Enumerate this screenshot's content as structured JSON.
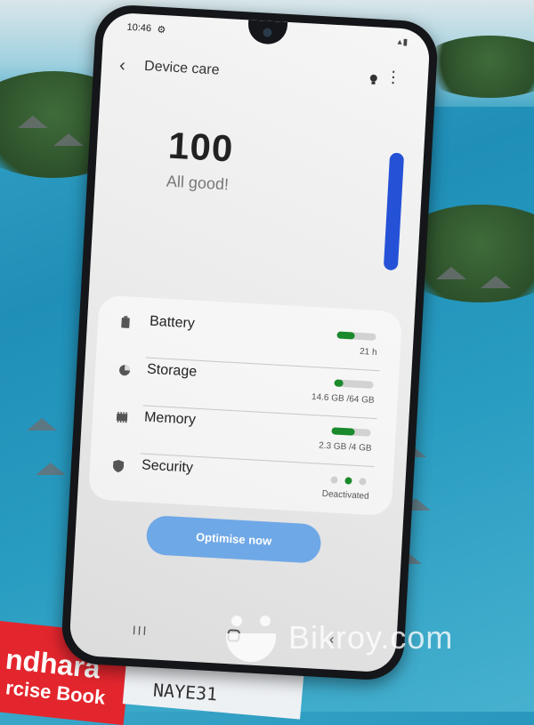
{
  "statusbar": {
    "time": "10:46",
    "gear_glyph": "⚙",
    "signal_glyph": "▴▮"
  },
  "appbar": {
    "back_glyph": "‹",
    "title": "Device care",
    "more_glyph": "⋮"
  },
  "summary": {
    "score": "100",
    "status": "All good!"
  },
  "items": [
    {
      "label": "Battery",
      "value": "21 h",
      "icon": "battery-icon",
      "fill": 0.45
    },
    {
      "label": "Storage",
      "value": "14.6 GB /64 GB",
      "icon": "storage-pie-icon",
      "fill": 0.23
    },
    {
      "label": "Memory",
      "value": "2.3 GB /4 GB",
      "icon": "memory-chip-icon",
      "fill": 0.58
    },
    {
      "label": "Security",
      "value": "Deactivated",
      "icon": "shield-icon"
    }
  ],
  "optimise_button": {
    "label": "Optimise now"
  },
  "navbar": {
    "recent_glyph": "III",
    "back_glyph": "‹"
  },
  "watermark": {
    "text": "Bikroy.com"
  },
  "background": {
    "book_title": "ndhara",
    "book_subtitle": "rcise Book",
    "handwriting": "NAYE31"
  },
  "colors": {
    "accent": "#2451d6",
    "button": "#6fa8e6",
    "good": "#1a8a2c"
  }
}
